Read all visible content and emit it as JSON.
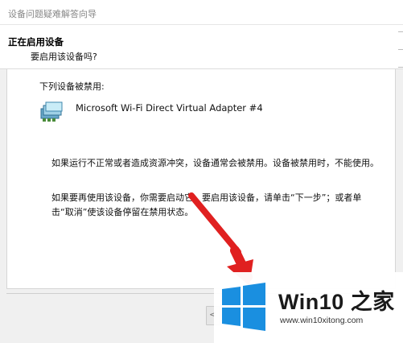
{
  "window": {
    "title": "设备问题疑难解答向导"
  },
  "header": {
    "title": "正在启用设备",
    "subtitle": "要启用该设备吗?"
  },
  "content": {
    "disabled_label": "下列设备被禁用:",
    "device": {
      "icon": "network-adapter-icon",
      "name": "Microsoft Wi-Fi Direct Virtual Adapter #4"
    },
    "paragraph1": "如果运行不正常或者造成资源冲突，设备通常会被禁用。设备被禁用时，不能使用。",
    "paragraph2": "如果要再使用该设备，你需要启动它。要启用该设备，请单击“下一步”；或者单击“取消”使该设备停留在禁用状态。"
  },
  "footer": {
    "back_label": "<"
  },
  "annotation": {
    "arrow_color": "#e02020"
  },
  "watermark": {
    "brand": "Win10 之家",
    "url": "www.win10xitong.com",
    "logo_color": "#1a8fe0"
  }
}
